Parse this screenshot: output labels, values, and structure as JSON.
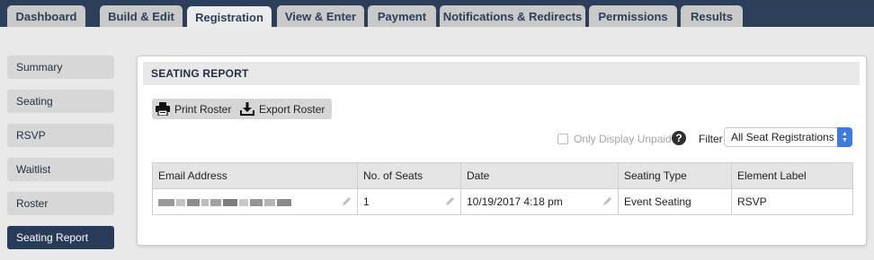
{
  "tabs": [
    {
      "label": "Dashboard",
      "active": false
    },
    {
      "label": "Build & Edit",
      "active": false
    },
    {
      "label": "Registration",
      "active": true
    },
    {
      "label": "View & Enter",
      "active": false
    },
    {
      "label": "Payment",
      "active": false
    },
    {
      "label": "Notifications & Redirects",
      "active": false
    },
    {
      "label": "Permissions",
      "active": false
    },
    {
      "label": "Results",
      "active": false
    }
  ],
  "sidebar": {
    "items": [
      {
        "label": "Summary",
        "active": false
      },
      {
        "label": "Seating",
        "active": false
      },
      {
        "label": "RSVP",
        "active": false
      },
      {
        "label": "Waitlist",
        "active": false
      },
      {
        "label": "Roster",
        "active": false
      },
      {
        "label": "Seating Report",
        "active": true
      }
    ]
  },
  "panel": {
    "title": "SEATING REPORT",
    "buttons": {
      "print_label": "Print Roster",
      "export_label": "Export Roster"
    },
    "only_unpaid_label": "Only Display Unpaid",
    "only_unpaid_checked": false,
    "help_symbol": "?",
    "filter_label": "Filter",
    "filter_value": "All Seat Registrations"
  },
  "table": {
    "columns": [
      "Email Address",
      "No. of Seats",
      "Date",
      "Seating Type",
      "Element Label"
    ],
    "rows": [
      {
        "email": "(redacted email address)",
        "seats": "1",
        "date": "10/19/2017 4:18 pm",
        "seating_type": "Event Seating",
        "element_label": "RSVP"
      }
    ]
  },
  "colors": {
    "topbar": "#2b3f5b",
    "active_sidebar": "#283c5a",
    "select_arrow": "#3c7be0"
  }
}
